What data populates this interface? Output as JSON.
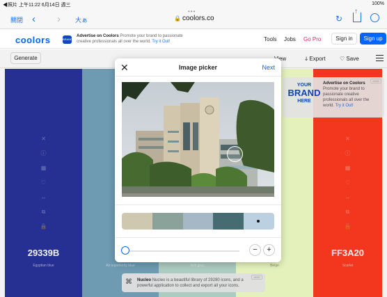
{
  "status_bar": {
    "left": "◀照片 上午11:22 6月14日 週三",
    "right": "100%"
  },
  "safari": {
    "close_tab": "關閉",
    "reader": "大ぁ",
    "dots": "•••",
    "url": "coolors.co",
    "lock_icon": "🔒"
  },
  "header": {
    "logo": "coolors",
    "ad_badge": "BRAND",
    "ad_title": "Advertise on Coolors",
    "ad_body": "Promote your brand to passionate creative professionals all over the world.",
    "ad_link": "Try it Out!",
    "nav": [
      "Tools",
      "Jobs",
      "Go Pro"
    ],
    "sign_in": "Sign in",
    "sign_up": "Sign up"
  },
  "toolbar": {
    "generate": "Generate",
    "view": "View",
    "export": "Export",
    "save": "Save"
  },
  "palette": [
    {
      "hex": "29339B",
      "name": "Egyptian blue",
      "color": "#29339b"
    },
    {
      "hex": "74",
      "name": "Air superiority blue",
      "color": "#74a4bc"
    },
    {
      "hex": "",
      "name": "Ash gray",
      "color": "#b6d6cc"
    },
    {
      "hex": "C6",
      "name": "Beige",
      "color": "#f1fec6"
    },
    {
      "hex": "FF3A20",
      "name": "Scarlet",
      "color": "#ff3a20"
    }
  ],
  "right_ad": {
    "brand_l1": "YOUR",
    "brand_l2": "BRAND",
    "brand_l3": "HERE",
    "title": "Advertise on Coolors",
    "body": "Promote your brand to passionate creative professionals all over the world.",
    "link": "Try it Out!",
    "hide": "HIDE"
  },
  "bottom_ad": {
    "title": "Nucleo",
    "body": "Nucleo is a beautiful library of 29280 icons, and a powerful application to collect and export all your icons.",
    "hide": "HIDE"
  },
  "modal": {
    "title": "Image picker",
    "close": "✕",
    "next": "Next",
    "swatches": [
      "#cfc8b0",
      "#8aa29a",
      "#a6b8c6",
      "#466c71",
      "#bbd0e0"
    ],
    "selected_swatch": 4,
    "minus": "−",
    "plus": "+"
  }
}
